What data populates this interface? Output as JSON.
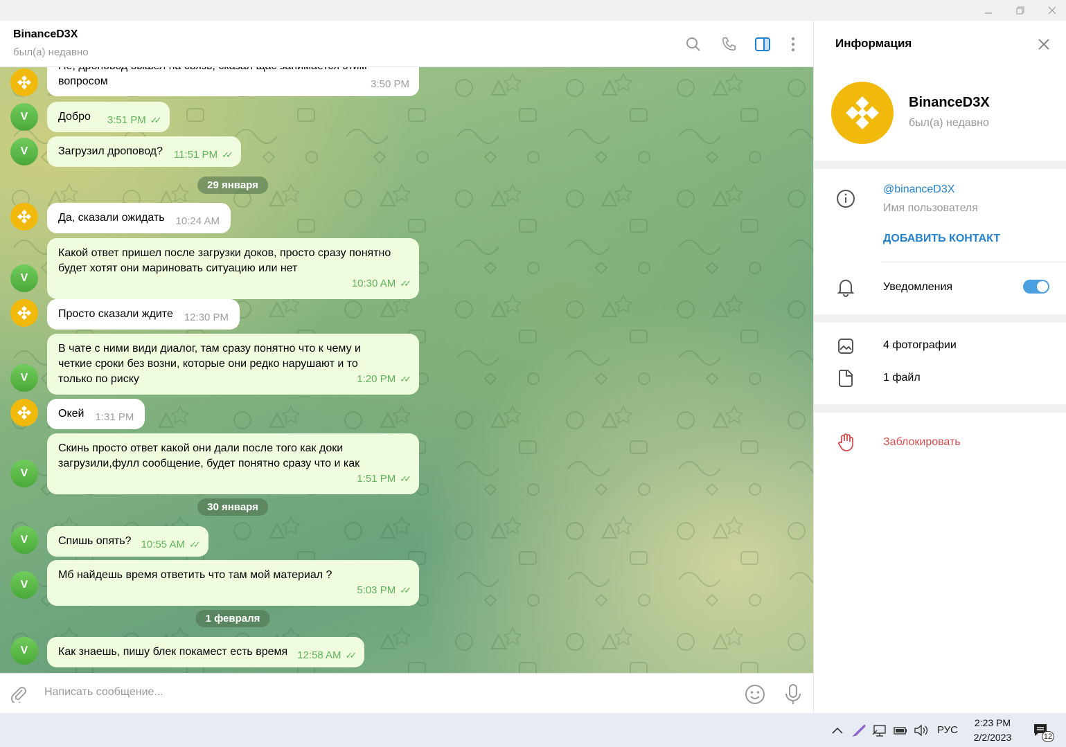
{
  "chat": {
    "title": "BinanceD3X",
    "status": "был(а) недавно"
  },
  "messages": [
    {
      "avatar": "binance",
      "text": "Не, дроповод вышел на связь, сказал щас занимается этим вопросом",
      "time": "3:50 PM"
    },
    {
      "avatar": "V",
      "text": "Добро",
      "time": "3:51 PM"
    },
    {
      "avatar": "V",
      "text": "Загрузил дроповод?",
      "time": "11:51 PM"
    },
    {
      "date": "29 января"
    },
    {
      "avatar": "binance",
      "text": "Да, сказали ожидать",
      "time": "10:24 AM"
    },
    {
      "avatar": "V",
      "text": "Какой ответ пришел после загрузки доков, просто сразу понятно будет хотят они мариновать ситуацию или нет",
      "time": "10:30 AM"
    },
    {
      "avatar": "binance",
      "text": "Просто сказали ждите",
      "time": "12:30 PM"
    },
    {
      "avatar": "V",
      "text": "В чате с ними види диалог, там сразу понятно что к чему и четкие сроки без возни, которые они редко нарушают и то только по риску",
      "time": "1:20 PM"
    },
    {
      "avatar": "binance",
      "text": "Окей",
      "time": "1:31 PM"
    },
    {
      "avatar": "V",
      "text": "Скинь просто ответ какой они дали после того как доки загрузили,фулл сообщение, будет понятно сразу что и как",
      "time": "1:51 PM"
    },
    {
      "date": "30 января"
    },
    {
      "avatar": "V",
      "text": "Спишь опять?",
      "time": "10:55 AM"
    },
    {
      "avatar": "V",
      "text": "Мб найдешь время ответить что там мой материал ?",
      "time": "5:03 PM"
    },
    {
      "date": "1 февраля"
    },
    {
      "avatar": "V",
      "text": "Как знаешь, пишу блек покамест есть время",
      "time": "12:58 AM"
    }
  ],
  "input": {
    "placeholder": "Написать сообщение..."
  },
  "info": {
    "title": "Информация",
    "name": "BinanceD3X",
    "status": "был(а) недавно",
    "username": "@binanceD3X",
    "username_label": "Имя пользователя",
    "add_contact": "ДОБАВИТЬ КОНТАКТ",
    "notifications": "Уведомления",
    "notifications_on": true,
    "photos": "4 фотографии",
    "files": "1 файл",
    "block": "Заблокировать"
  },
  "taskbar": {
    "lang": "РУС",
    "time": "2:23 PM",
    "date": "2/2/2023",
    "notif_count": "12"
  },
  "colors": {
    "accent": "#2481cc",
    "outgoing_bubble": "#effdde",
    "time_green": "#5fb35b",
    "binance_yellow": "#f0b90b",
    "danger": "#d14e4e"
  },
  "icons": {
    "header": [
      "search-icon",
      "phone-icon",
      "sidebar-toggle-icon",
      "more-vertical-icon"
    ],
    "input": [
      "attach-icon",
      "emoji-icon",
      "mic-icon"
    ],
    "info": [
      "info-icon",
      "bell-icon",
      "photo-icon",
      "file-icon",
      "block-hand-icon"
    ]
  }
}
